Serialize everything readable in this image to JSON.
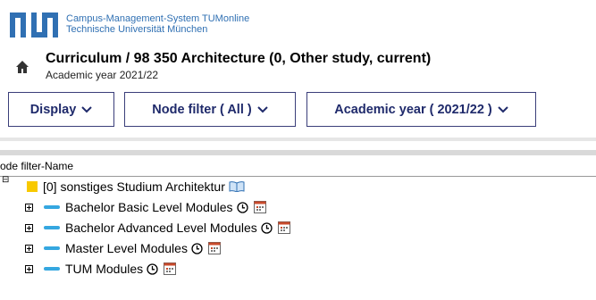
{
  "header": {
    "brand_line1": "Campus-Management-System TUMonline",
    "brand_line2": "Technische Universität München",
    "page_title": "Curriculum / 98 350 Architecture (0, Other study, current)",
    "subtitle": "Academic year 2021/22"
  },
  "toolbar": {
    "display_label": "Display",
    "node_filter_label": "Node filter ( All )",
    "academic_year_label": "Academic year ( 2021/22 )"
  },
  "tree": {
    "column_header": "ode filter-Name",
    "root": {
      "label": "[0] sonstiges Studium Architektur"
    },
    "children": [
      {
        "label": "Bachelor Basic Level Modules"
      },
      {
        "label": "Bachelor Advanced Level Modules"
      },
      {
        "label": "Master Level Modules"
      },
      {
        "label": "TUM Modules"
      }
    ]
  },
  "colors": {
    "tum_blue": "#3070b3",
    "button_text": "#1f2a6b",
    "folder_yellow": "#f8c900",
    "module_bar_blue": "#35a7e0"
  }
}
